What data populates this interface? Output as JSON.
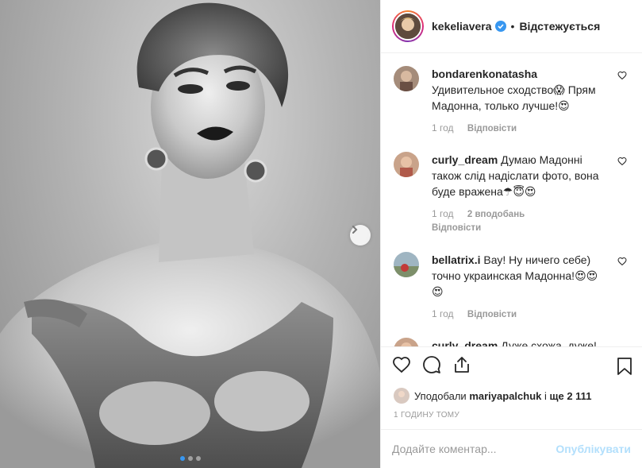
{
  "post": {
    "author": "kekeliavera",
    "verified": true,
    "separator": "•",
    "follow_state": "Відстежується"
  },
  "photo": {
    "carousel_index": 1,
    "carousel_total": 3
  },
  "comments": [
    {
      "user": "bondarenkonatasha",
      "text": "Удивительное сходство😱 Прям Мадонна, только лучше!😍",
      "time": "1 год",
      "likes": "",
      "reply": "Відповісти"
    },
    {
      "user": "curly_dream",
      "text": "Думаю Мадонні також слід надіслати фото, вона буде вражена☂😇😍",
      "time": "1 год",
      "likes": "2 вподобань",
      "reply": "Відповісти"
    },
    {
      "user": "bellatrix.i",
      "text": "Вау! Ну ничего себе) точно украинская Мадонна!😍😍😍",
      "time": "1 год",
      "likes": "",
      "reply": "Відповісти"
    },
    {
      "user": "curly_dream",
      "text": "Дуже схожа, дуже!",
      "time": "",
      "likes": "",
      "reply": ""
    }
  ],
  "likes": {
    "prefix": "Уподобали",
    "user": "mariyapalchuk",
    "joiner": "і",
    "more": "ще 2 111"
  },
  "time_ago": "1 ГОДИНУ ТОМУ",
  "add_comment": {
    "placeholder": "Додайте коментар...",
    "post_label": "Опублікувати"
  },
  "colors": {
    "verified": "#3897f0",
    "post_button_disabled": "#b2dffc",
    "muted": "#999999"
  }
}
